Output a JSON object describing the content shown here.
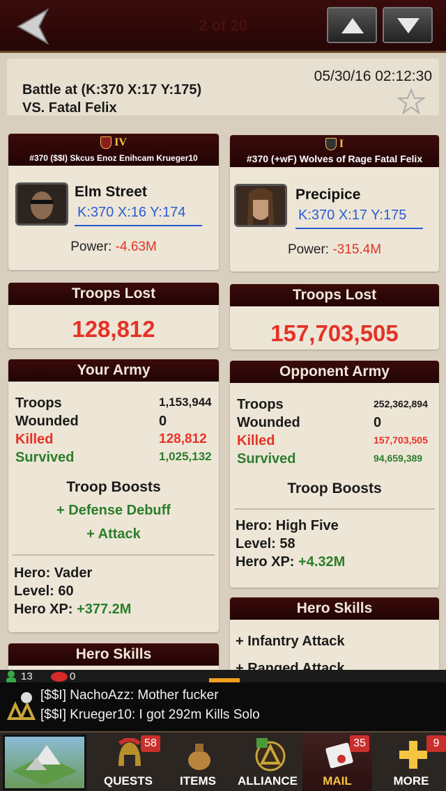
{
  "topbar": {
    "page_count": "2 of 20"
  },
  "battle": {
    "date": "05/30/16 02:12:30",
    "title": "Battle at (K:370 X:17 Y:175)",
    "vs": "VS. Fatal Felix"
  },
  "attacker": {
    "rank": "IV",
    "alliance_line": "#370 ($$I) Skcus Enoz Enihcam Krueger10",
    "name": "Elm Street",
    "coords": "K:370 X:16 Y:174",
    "power_label": "Power:",
    "power_value": "-4.63M",
    "troops_lost_title": "Troops Lost",
    "troops_lost": "128,812",
    "army_title": "Your Army",
    "stats": [
      {
        "label": "Troops",
        "value": "1,153,944"
      },
      {
        "label": "Wounded",
        "value": "0"
      },
      {
        "label": "Killed",
        "value": "128,812"
      },
      {
        "label": "Survived",
        "value": "1,025,132"
      }
    ],
    "boosts_title": "Troop Boosts",
    "boosts": [
      "+ Defense Debuff",
      "+ Attack"
    ],
    "hero": "Hero: Vader",
    "level": "Level: 60",
    "hero_xp_label": "Hero XP:",
    "hero_xp_value": "+377.2M",
    "skills_title": "Hero Skills"
  },
  "defender": {
    "rank": "I",
    "alliance_line": "#370 (+wF) Wolves of Rage Fatal Felix",
    "name": "Precipice",
    "coords": "K:370 X:17 Y:175",
    "power_label": "Power:",
    "power_value": "-315.4M",
    "troops_lost_title": "Troops Lost",
    "troops_lost": "157,703,505",
    "army_title": "Opponent Army",
    "stats": [
      {
        "label": "Troops",
        "value": "252,362,894"
      },
      {
        "label": "Wounded",
        "value": "0"
      },
      {
        "label": "Killed",
        "value": "157,703,505"
      },
      {
        "label": "Survived",
        "value": "94,659,389"
      }
    ],
    "boosts_title": "Troop Boosts",
    "hero": "Hero: High Five",
    "level": "Level: 58",
    "hero_xp_label": "Hero XP:",
    "hero_xp_value": "+4.32M",
    "skills_title": "Hero Skills",
    "skills": [
      "+ Infantry Attack",
      "+ Ranged Attack"
    ]
  },
  "chat": {
    "online_count": "13",
    "other_count": "0",
    "messages": [
      "[$$I] NachoAzz: Mother fucker",
      "[$$I] Krueger10: I got 292m Kills Solo"
    ]
  },
  "bottom_nav": {
    "tabs": [
      {
        "label": "QUESTS",
        "badge": "58"
      },
      {
        "label": "ITEMS",
        "badge": ""
      },
      {
        "label": "ALLIANCE",
        "badge": ""
      },
      {
        "label": "MAIL",
        "badge": "35"
      },
      {
        "label": "MORE",
        "badge": "9"
      }
    ]
  },
  "colors": {
    "negative": "#e53227",
    "positive": "#2c7d2c",
    "link": "#2a5bd7",
    "header_bg": "#2a0606",
    "active_tab": "#f5c542"
  }
}
